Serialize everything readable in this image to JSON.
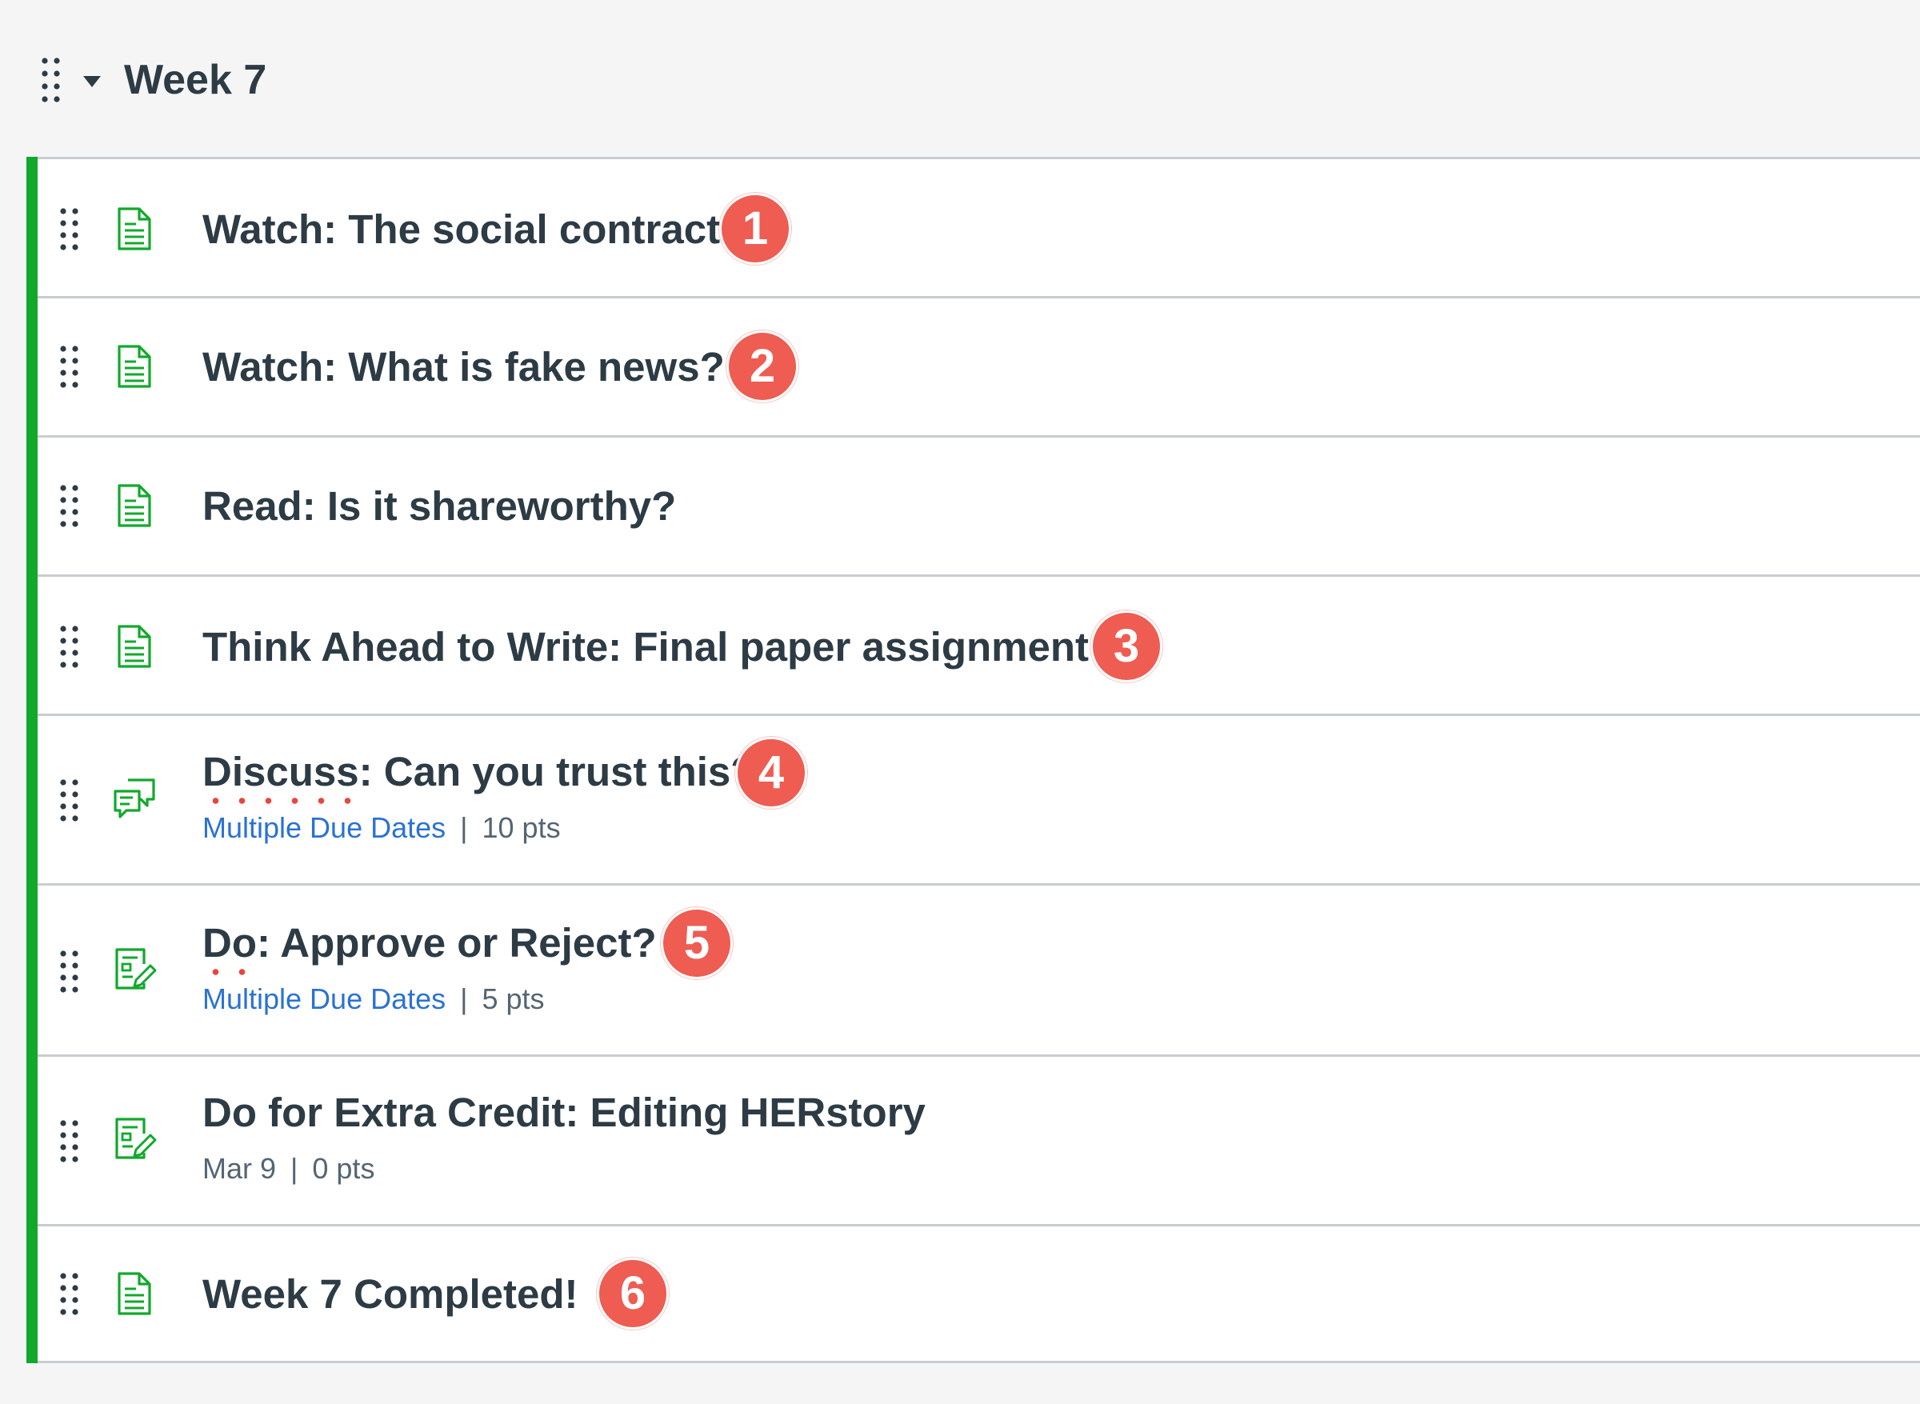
{
  "module": {
    "title": "Week 7",
    "accent_color": "#12a82c"
  },
  "icons": {
    "drag": "drag-handle-icon",
    "collapse": "caret-down-icon",
    "page": "document-icon",
    "discussion": "discussion-icon",
    "assignment": "assignment-icon"
  },
  "items": [
    {
      "type": "page",
      "title": "Watch: The social contract",
      "badge": "1"
    },
    {
      "type": "page",
      "title": "Watch: What is fake news?",
      "badge": "2"
    },
    {
      "type": "page",
      "title": "Read: Is it shareworthy?"
    },
    {
      "type": "page",
      "title": "Think Ahead to Write: Final paper assignment",
      "badge": "3"
    },
    {
      "type": "discussion",
      "title_flagged": "Discuss",
      "title_rest": ": Can you trust this?",
      "badge": "4",
      "due": "Multiple Due Dates",
      "separator": "|",
      "points": "10 pts"
    },
    {
      "type": "assignment",
      "title_flagged": "Do",
      "title_rest": ": Approve or Reject?",
      "badge": "5",
      "due": "Multiple Due Dates",
      "separator": "|",
      "points": "5 pts"
    },
    {
      "type": "assignment",
      "title": "Do for Extra Credit: Editing HERstory",
      "due": "Mar 9",
      "separator": "|",
      "points": "0 pts"
    },
    {
      "type": "page",
      "title": "Week 7 Completed!",
      "badge": "6"
    }
  ],
  "colors": {
    "badge": "#ee5c52",
    "link": "#2b72d3",
    "icon_green": "#12a82c",
    "text": "#2d3b45",
    "meta_text": "#556572",
    "divider": "#c7cdd1"
  }
}
